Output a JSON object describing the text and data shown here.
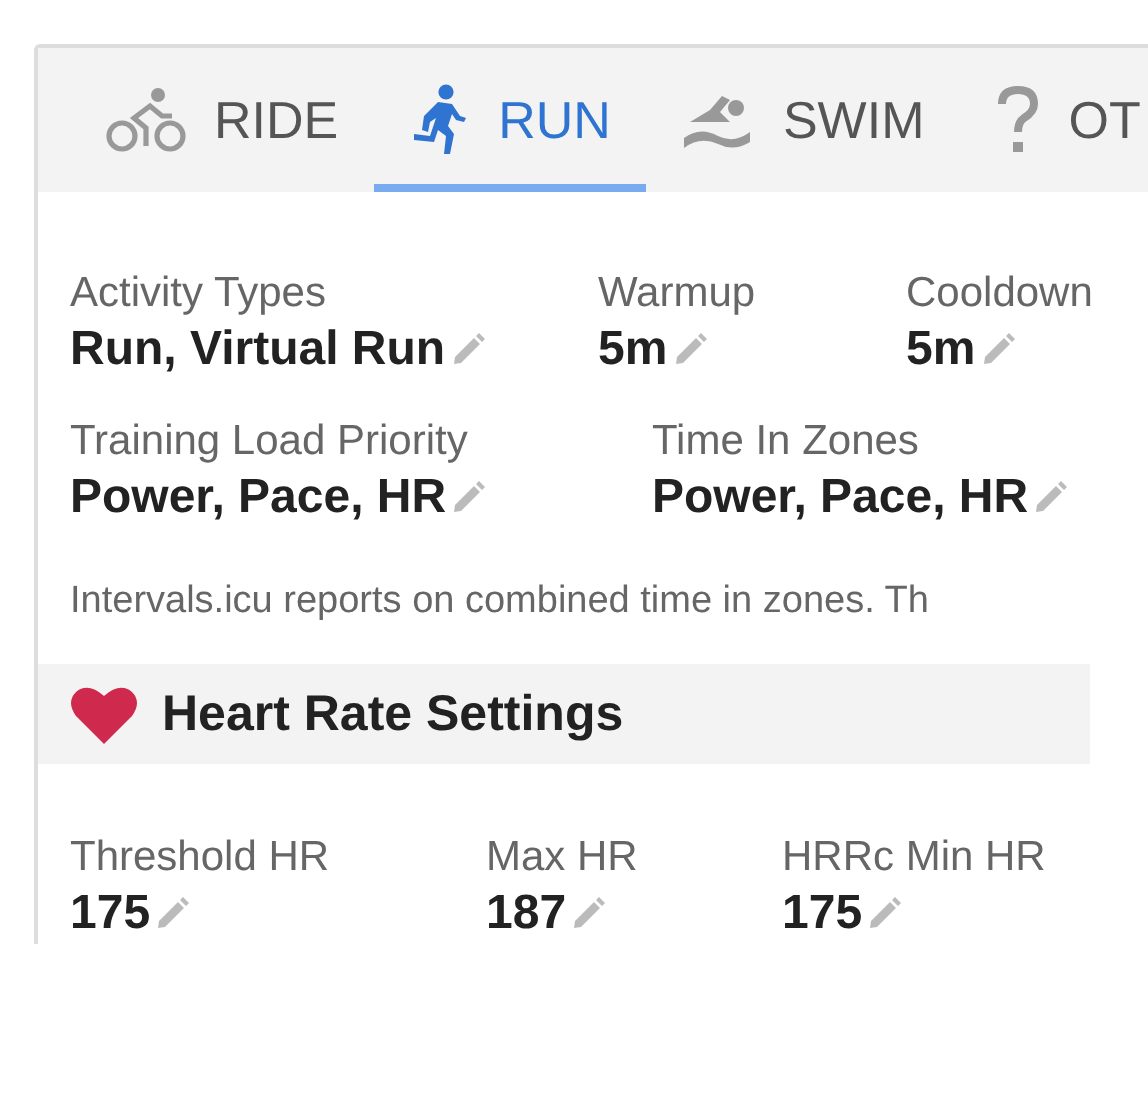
{
  "tabs": [
    {
      "label": "RIDE",
      "kind": "bike",
      "selected": false
    },
    {
      "label": "RUN",
      "kind": "run",
      "selected": true
    },
    {
      "label": "SWIM",
      "kind": "swim",
      "selected": false
    },
    {
      "label": "OT",
      "kind": "other",
      "selected": false
    }
  ],
  "general": {
    "rows": [
      [
        {
          "label": "Activity Types",
          "value": "Run, Virtual Run"
        },
        {
          "label": "Warmup",
          "value": "5m"
        },
        {
          "label": "Cooldown",
          "value": "5m"
        }
      ],
      [
        {
          "label": "Training Load Priority",
          "value": "Power, Pace, HR"
        },
        {
          "label": "Time In Zones",
          "value": "Power, Pace, HR"
        }
      ]
    ],
    "note": "Intervals.icu reports on combined time in zones. Th"
  },
  "heart_rate": {
    "title": "Heart Rate Settings",
    "fields": [
      {
        "label": "Threshold HR",
        "value": "175"
      },
      {
        "label": "Max HR",
        "value": "187"
      },
      {
        "label": "HRRc Min HR",
        "value": "175"
      }
    ]
  }
}
